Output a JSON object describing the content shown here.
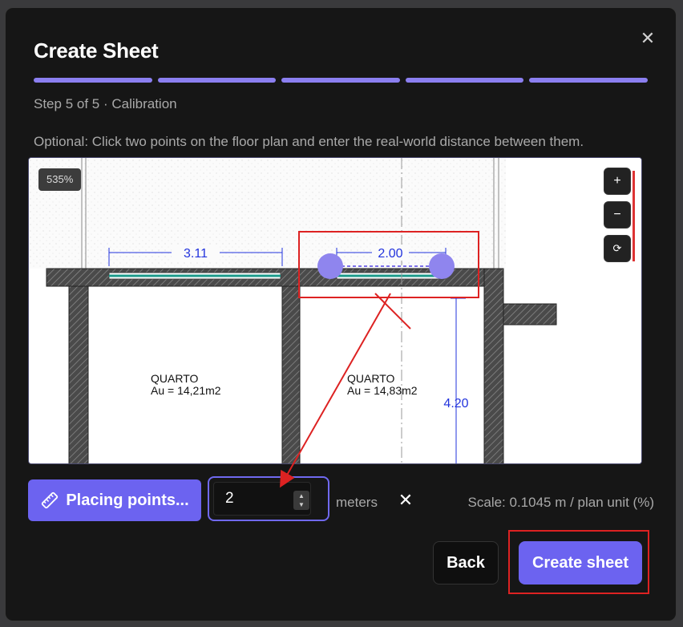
{
  "dialog": {
    "title": "Create Sheet",
    "close_symbol": "✕",
    "step_label": "Step 5 of 5 · Calibration",
    "instructions": "Optional: Click two points on the floor plan and enter the real-world distance between them.",
    "progress_steps": 5,
    "progress_completed": 5,
    "accent_color": "#6c63f0"
  },
  "viewer": {
    "zoom_level": "535%",
    "zoom_in_label": "+",
    "zoom_out_label": "−",
    "zoom_reset_label": "⟳",
    "plan": {
      "dim_top_left": "3.11",
      "dim_top_middle": "2.00",
      "dim_vertical": "4.20",
      "room_left_name": "QUARTO",
      "room_left_area": "Au = 14,21m2",
      "room_right_name": "QUARTO",
      "room_right_area": "Au = 14,83m2"
    }
  },
  "calibration": {
    "place_button_label": "Placing points...",
    "place_icon": "ruler-icon",
    "distance_value": "2",
    "unit_label": "meters",
    "clear_symbol": "✕",
    "spinner_up": "▲",
    "spinner_down": "▼",
    "scale_text": "Scale: 0.1045 m / plan unit (%)"
  },
  "footer": {
    "back_label": "Back",
    "create_label": "Create sheet"
  }
}
